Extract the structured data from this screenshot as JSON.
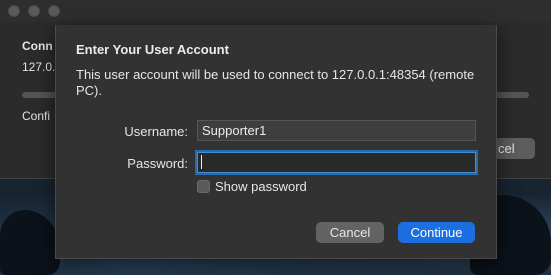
{
  "parent_window": {
    "line1": "Conn",
    "line2": "127.0.",
    "line3": "Confi",
    "button_label": "cel"
  },
  "dialog": {
    "title": "Enter Your User Account",
    "message": "This user account will be used to connect to 127.0.0.1:48354 (remote PC).",
    "username_label": "Username:",
    "username_value": "Supporter1",
    "password_label": "Password:",
    "password_value": "",
    "show_password_label": "Show password",
    "show_password_checked": false,
    "cancel_label": "Cancel",
    "continue_label": "Continue"
  }
}
